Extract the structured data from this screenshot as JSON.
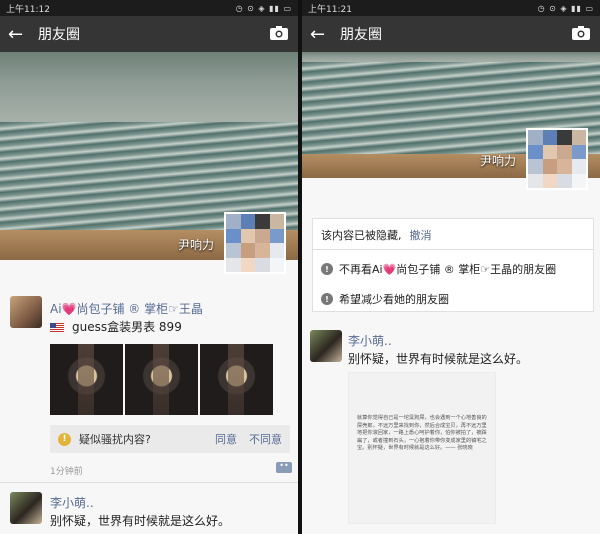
{
  "left": {
    "status_time": "上午11:12",
    "header_title": "朋友圈",
    "owner_name": "尹响力",
    "post1": {
      "author": "Ai💗尚包子铺 ® 掌柜☞王晶",
      "text": "guess盒装男表 899",
      "spam_question": "疑似骚扰内容?",
      "agree": "同意",
      "disagree": "不同意",
      "time": "1分钟前"
    },
    "post2": {
      "author": "李小萌..",
      "text": "别怀疑，世界有时候就是这么好。"
    }
  },
  "right": {
    "status_time": "上午11:21",
    "header_title": "朋友圈",
    "owner_name": "尹响力",
    "hidden_notice": "该内容已被隐藏,",
    "undo": "撤消",
    "option1": "不再看Ai💗尚包子铺 ® 掌柜☞王晶的朋友圈",
    "option2": "希望减少看她的朋友圈",
    "post2": {
      "author": "李小萌..",
      "text": "别怀疑，世界有时候就是这么好。",
      "image_text": "就算你觉得自己是一坨臭狗屎，也会遇到一个心地善良的屎壳郎，不远万里来找到你，然后合成宝贝，再不远万里地把你滚回家，一路上悉心呵护着你，怕你被拍了，被踩扁了，或者撞到石头，一心抱着你带你变成家里的镇宅之宝。别怀疑，世界有时候就是这么好。—— 张晓晓"
    }
  },
  "colors": {
    "header_bg": "#353535",
    "link_blue": "#576b95",
    "warning_yellow": "#e4b33a"
  },
  "icons": [
    "back-arrow-icon",
    "camera-icon",
    "warning-icon",
    "comment-icon",
    "info-icon"
  ]
}
